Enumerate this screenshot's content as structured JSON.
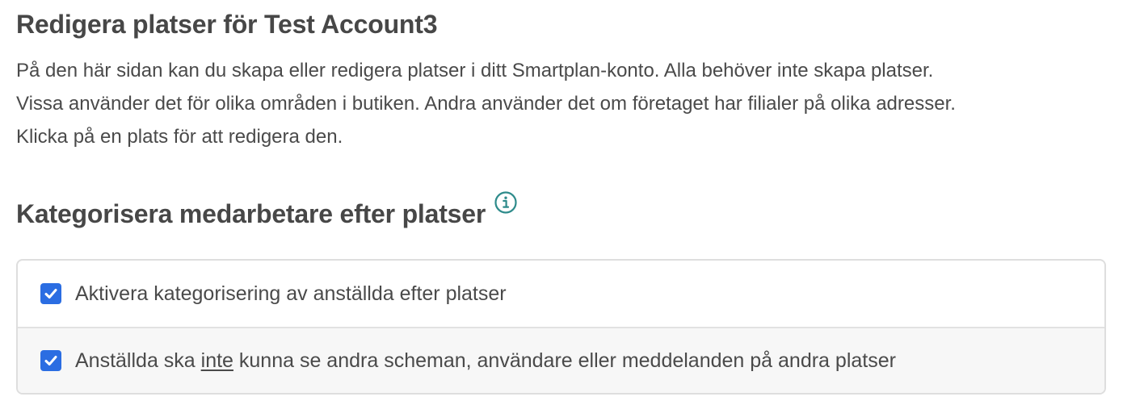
{
  "page": {
    "title": "Redigera platser för Test Account3",
    "intro_lines": [
      "På den här sidan kan du skapa eller redigera platser i ditt Smartplan-konto. Alla behöver inte skapa platser.",
      "Vissa använder det för olika områden i butiken. Andra använder det om företaget har filialer på olika adresser.",
      "Klicka på en plats för att redigera den."
    ]
  },
  "section": {
    "title": "Kategorisera medarbetare efter platser",
    "info_icon": "info-circle-icon",
    "info_icon_color": "#2e8b8b"
  },
  "options": [
    {
      "checked": true,
      "label": "Aktivera kategorisering av anställda efter platser"
    },
    {
      "checked": true,
      "label_before": "Anställda ska ",
      "label_emphasis": "inte",
      "label_after": " kunna se andra scheman, användare eller meddelanden på andra platser"
    }
  ],
  "colors": {
    "checkbox": "#2b6de2",
    "text": "#4a4a4a",
    "border": "#dedede"
  }
}
